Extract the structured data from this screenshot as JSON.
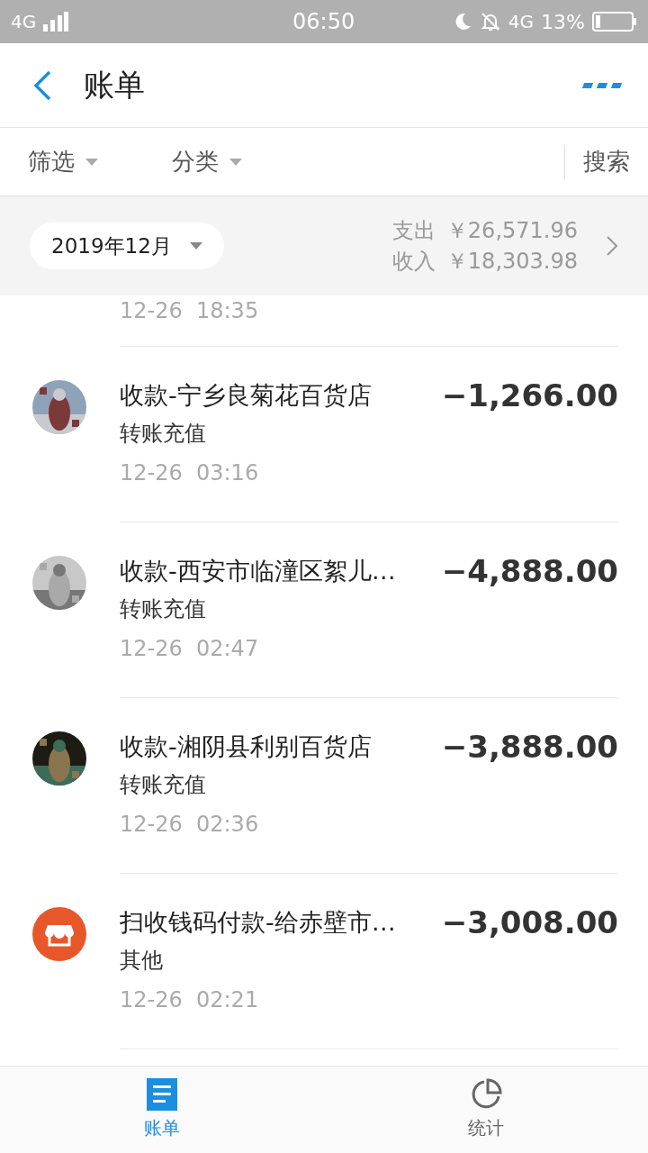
{
  "status_bar": {
    "network_left": "4G",
    "time": "06:50",
    "network_right": "4G",
    "battery": "13%"
  },
  "header": {
    "title": "账单"
  },
  "filters": [
    {
      "label": "筛选"
    },
    {
      "label": "分类"
    }
  ],
  "search": "搜索",
  "summary": {
    "month": "2019年12月",
    "expense_label": "支出",
    "expense": "￥26,571.96",
    "income_label": "收入",
    "income": "￥18,303.98"
  },
  "partial_row": {
    "time": "12-26  18:35"
  },
  "transactions": [
    {
      "kind": "picture",
      "title": "收款-宁乡良菊花百货店",
      "category": "转账充值",
      "time": "12-26  03:16",
      "amount": "−1,266.00"
    },
    {
      "kind": "picture",
      "title": "收款-西安市临潼区絮儿…",
      "category": "转账充值",
      "time": "12-26  02:47",
      "amount": "−4,888.00"
    },
    {
      "kind": "picture",
      "title": "收款-湘阴县利别百货店",
      "category": "转账充值",
      "time": "12-26  02:36",
      "amount": "−3,888.00"
    },
    {
      "kind": "store",
      "title": "扫收钱码付款-给赤壁市…",
      "category": "其他",
      "time": "12-26  02:21",
      "amount": "−3,008.00"
    }
  ],
  "tabs": [
    {
      "label": "账单",
      "kind": "bills",
      "selected": true
    },
    {
      "label": "统计",
      "kind": "stats",
      "selected": false
    }
  ]
}
